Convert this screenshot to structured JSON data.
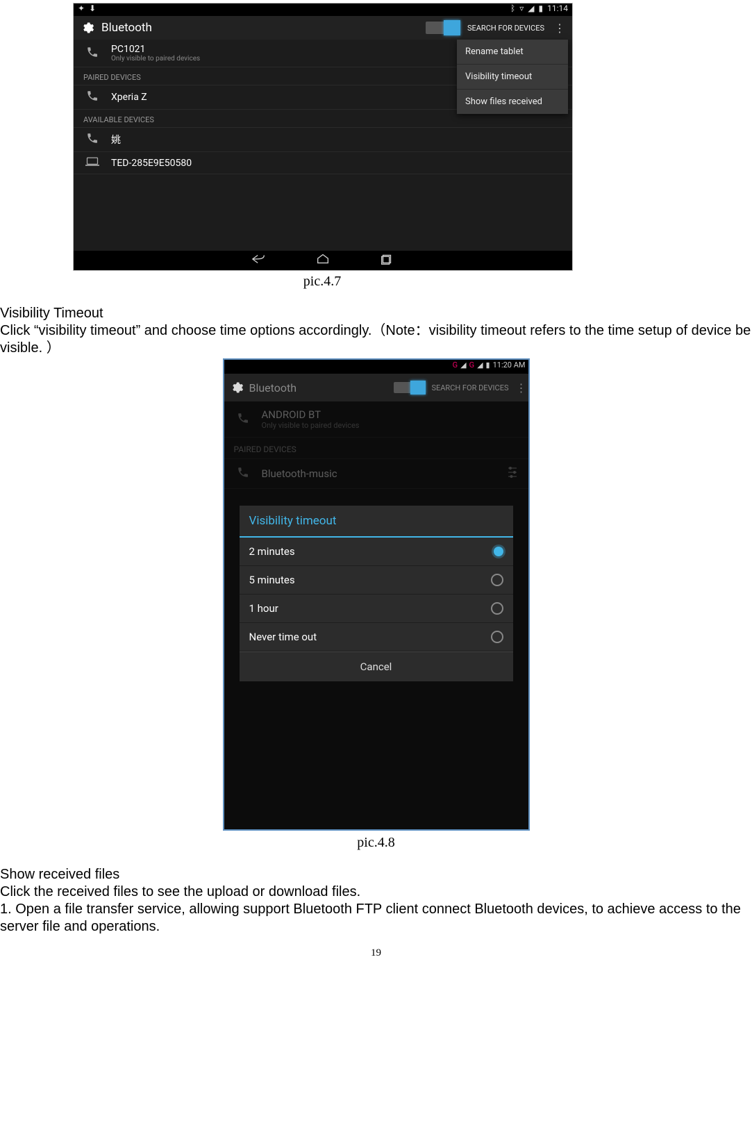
{
  "fig1": {
    "caption": "pic.4.7",
    "status": {
      "time": "11:14"
    },
    "action": {
      "title": "Bluetooth",
      "search": "SEARCH FOR DEVICES"
    },
    "menu": {
      "rename": "Rename tablet",
      "vt": "Visibility timeout",
      "sfr": "Show files received"
    },
    "self": {
      "name": "PC1021",
      "sub": "Only visible to paired devices"
    },
    "sections": {
      "paired": "PAIRED DEVICES",
      "available": "AVAILABLE DEVICES"
    },
    "paired": [
      {
        "name": "Xperia Z"
      }
    ],
    "available": [
      {
        "name": "姚"
      },
      {
        "name": "TED-285E9E50580"
      }
    ]
  },
  "text1": {
    "h": "Visibility Timeout",
    "p": "Click “visibility timeout” and choose time options accordingly.（Note：visibility timeout refers to the time setup of device be visible. ）"
  },
  "fig2": {
    "caption": "pic.4.8",
    "status": {
      "time": "11:20 AM",
      "net1": "G",
      "net2": "G"
    },
    "action": {
      "title": "Bluetooth",
      "search": "SEARCH FOR DEVICES"
    },
    "self": {
      "name": "ANDROID BT",
      "sub": "Only visible to paired devices"
    },
    "sections": {
      "paired": "PAIRED DEVICES"
    },
    "paired": [
      {
        "name": "Bluetooth-music"
      }
    ],
    "dialog": {
      "title": "Visibility timeout",
      "options": [
        {
          "label": "2 minutes",
          "selected": true
        },
        {
          "label": "5 minutes",
          "selected": false
        },
        {
          "label": "1 hour",
          "selected": false
        },
        {
          "label": "Never time out",
          "selected": false
        }
      ],
      "cancel": "Cancel"
    }
  },
  "text2": {
    "h": "Show received files",
    "p1": "Click the received files to see the upload or download files.",
    "p2": "1. Open a file transfer service, allowing support Bluetooth FTP client connect Bluetooth devices, to achieve access to the server file and operations."
  },
  "pagenum": "19"
}
